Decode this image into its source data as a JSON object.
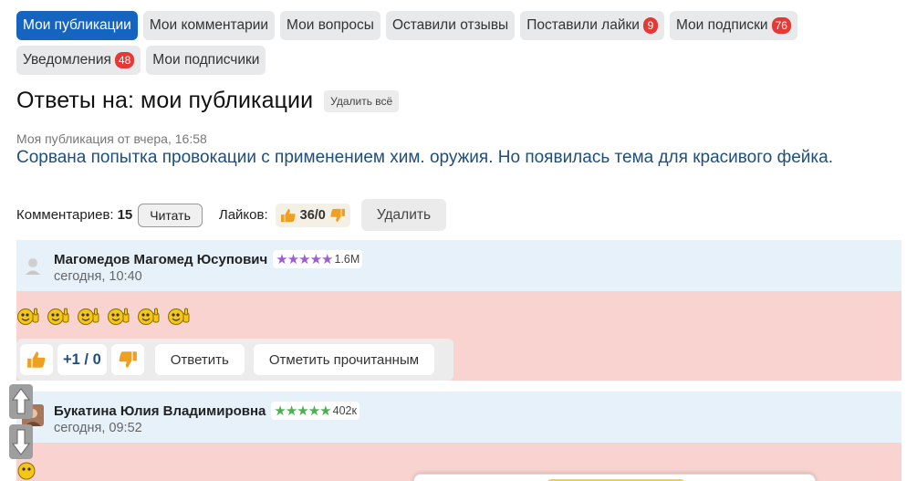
{
  "tabs_row1": [
    {
      "label": "Мои публикации",
      "active": true
    },
    {
      "label": "Мои комментарии"
    },
    {
      "label": "Мои вопросы"
    },
    {
      "label": "Оставили отзывы"
    },
    {
      "label": "Поставили лайки",
      "badge": "9"
    },
    {
      "label": "Мои подписки",
      "badge": "76"
    }
  ],
  "tabs_row2": [
    {
      "label": "Уведомления",
      "badge": "48"
    },
    {
      "label": "Мои подписчики"
    }
  ],
  "heading": {
    "title": "Ответы на: мои публикации",
    "delete_all": "Удалить всё"
  },
  "publication": {
    "meta": "Моя публикация от вчера, 16:58",
    "title": "Сорвана попытка провокации с применением хим. оружия. Но появилась тема для красивого фейка."
  },
  "stats": {
    "comments_label": "Комментариев:",
    "comments_count": "15",
    "read_btn": "Читать",
    "likes_label": "Лайков:",
    "likes_value": "36/0",
    "delete_btn": "Удалить"
  },
  "comments": [
    {
      "author": "Магомедов Магомед Юсупович",
      "stars": "★★★★★",
      "star_color": "#9c5fd1",
      "rating": "1.6М",
      "time": "сегодня, 10:40",
      "smiley_count": 6,
      "score": "+1 / 0",
      "reply": "Ответить",
      "mark_read": "Отметить прочитанным"
    },
    {
      "author": "Букатина Юлия Владимировна",
      "stars": "★★★★★",
      "star_color": "#4caf50",
      "rating": "402к",
      "time": "сегодня, 09:52"
    }
  ],
  "colors": {
    "accent": "#1565c0",
    "badge": "#e53935",
    "comment_head": "#e6f1fa",
    "comment_body": "#f8d3cf",
    "link": "#1f4e7a"
  },
  "icons": [
    "thumb-up-icon",
    "thumb-down-icon",
    "smiley-thumbs-up-icon",
    "scroll-up-icon",
    "scroll-down-icon",
    "avatar-icon"
  ]
}
